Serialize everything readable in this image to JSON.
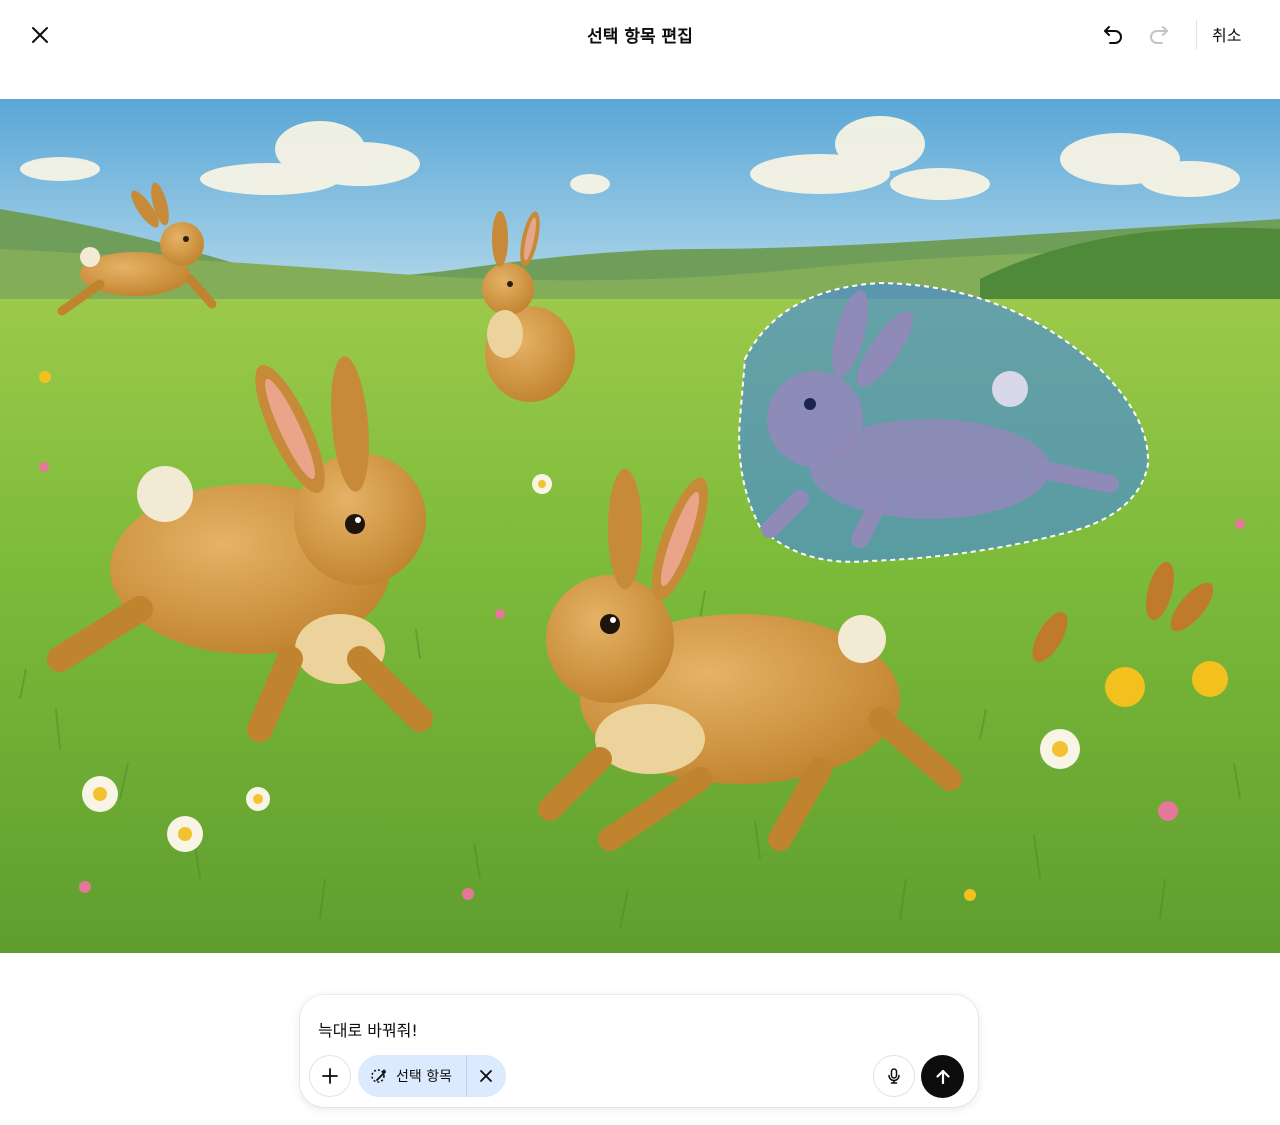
{
  "header": {
    "title": "선택 항목 편집",
    "cancel_label": "취소",
    "close_icon": "close-icon",
    "undo_icon": "undo-icon",
    "redo_icon": "redo-icon"
  },
  "canvas": {
    "description_icon": "painting-image",
    "selection_state": "active"
  },
  "composer": {
    "prompt_value": "늑대로 바꿔줘!",
    "selection_chip_label": "선택 항목",
    "plus_icon": "plus-icon",
    "mic_icon": "mic-icon",
    "send_icon": "arrow-up-icon"
  },
  "colors": {
    "accent_chip": "#dbeafe",
    "send_button": "#0d0d0d",
    "selection_overlay": "#3b82f6"
  }
}
